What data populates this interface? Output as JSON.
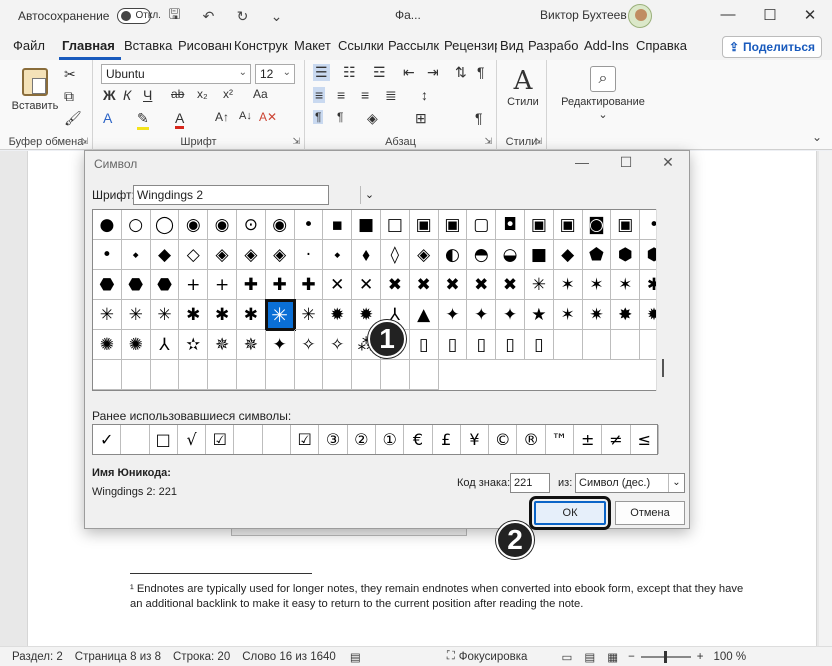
{
  "titlebar": {
    "autosave_label": "Автосохранение",
    "autosave_state": "Откл.",
    "doc_title": "Фа...",
    "user_name": "Виктор Бухтеев",
    "minimize": "—",
    "maximize": "☐",
    "close": "✕"
  },
  "quick_access": {
    "save": "🖫",
    "undo": "↶",
    "redo": "↻",
    "more": "⌄"
  },
  "tabs": [
    "Файл",
    "Главная",
    "Вставка",
    "Рисовани",
    "Конструк",
    "Макет",
    "Ссылки",
    "Рассылк",
    "Рецензир",
    "Вид",
    "Разрабо",
    "Add-Ins",
    "Справка"
  ],
  "share_label": "Поделиться",
  "ribbon": {
    "paste_label": "Вставить",
    "clipboard_label": "Буфер обмена",
    "font_name": "Ubuntu",
    "font_size": "12",
    "font_group_label": "Шрифт",
    "paragraph_label": "Абзац",
    "styles_label": "Стили",
    "styles_group_label": "Стили",
    "editing_label": "Редактирование",
    "bold": "Ж",
    "italic": "К",
    "underline": "Ч",
    "strike": "ab",
    "sub": "x₂",
    "sup": "x²",
    "text_effects": "A",
    "highlight": "✎",
    "font_color": "A",
    "grow": "A↑",
    "shrink": "A↓",
    "case": "Aa",
    "clear": "A✕",
    "ltr": "¶",
    "rtl": "¶",
    "pilcrow": "¶",
    "sort": "⇅",
    "styles_icon": "A",
    "editing_icon": "⌕",
    "editing_arrow": "⌄"
  },
  "document": {
    "footnote": "¹ Endnotes are typically used for longer notes, they remain endnotes when converted into ebook form, except that they have an additional backlink to make it easy to return to the current position after reading the note."
  },
  "dialog": {
    "title": "Символ",
    "font_label": "Шрифт:",
    "font_value": "Wingdings 2",
    "symbols": [
      "●",
      "○",
      "◯",
      "◉",
      "◉",
      "⊙",
      "◉",
      "•",
      "▪",
      "■",
      "□",
      "▣",
      "▣",
      "▢",
      "◘",
      "▣",
      "▣",
      "◙",
      "▣",
      "•",
      "•",
      "⬩",
      "◆",
      "◇",
      "◈",
      "◈",
      "◈",
      "·",
      "⬩",
      "⬧",
      "◊",
      "◈",
      "◐",
      "◓",
      "◒",
      "■",
      "◆",
      "⬟",
      "⬢",
      "⬢",
      "⬣",
      "⬣",
      "⬣",
      "+",
      "+",
      "✚",
      "✚",
      "✚",
      "✕",
      "✕",
      "✖",
      "✖",
      "✖",
      "✖",
      "✖",
      "✳",
      "✶",
      "✶",
      "✶",
      "✱",
      "✳",
      "✳",
      "✳",
      "✱",
      "✱",
      "✱",
      "✳",
      "✳",
      "✹",
      "✹",
      "⅄",
      "▲",
      "✦",
      "✦",
      "✦",
      "★",
      "✶",
      "✷",
      "✸",
      "✹",
      "✺",
      "✺",
      "⅄",
      "✫",
      "✵",
      "✵",
      "✦",
      "✧",
      "✧",
      "⁂",
      "▯",
      "▯",
      "▯",
      "▯",
      "▯",
      "▯",
      "",
      "",
      "",
      "",
      "",
      "",
      "",
      "",
      "",
      "",
      "",
      "",
      "",
      "",
      "",
      ""
    ],
    "selected_index": 66,
    "recent_label": "Ранее использовавшиеся символы:",
    "recent_symbols": [
      "✓",
      "",
      "□",
      "√",
      "☑",
      "",
      "",
      "☑",
      "③",
      "②",
      "①",
      "€",
      "£",
      "¥",
      "©",
      "®",
      "™",
      "±",
      "≠",
      "≤"
    ],
    "unicode_name_label": "Имя Юникода:",
    "unicode_name": "Wingdings 2: 221",
    "code_label": "Код знака:",
    "code_value": "221",
    "from_label": "из:",
    "from_value": "Символ (дес.)",
    "ok_label": "ОК",
    "cancel_label": "Отмена",
    "close_icon": "✕",
    "max_icon": "☐",
    "min_icon": "—"
  },
  "markers": {
    "one": "1",
    "two": "2"
  },
  "statusbar": {
    "section": "Раздел: 2",
    "page": "Страница 8 из 8",
    "line": "Строка: 20",
    "word": "Слово 16 из 1640",
    "focus": "Фокусировка",
    "zoom": "100 %"
  }
}
